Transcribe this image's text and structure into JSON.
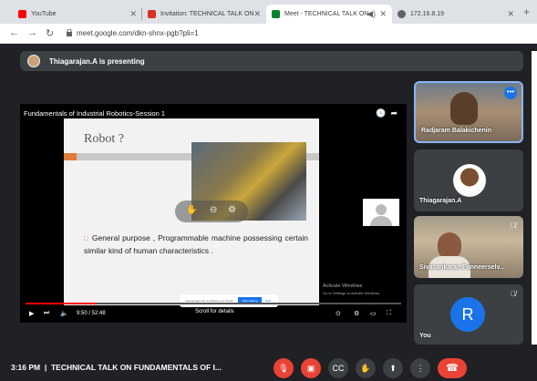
{
  "browser": {
    "tabs": [
      {
        "title": "YouTube",
        "icon": "youtube-icon",
        "color": "#ff0000"
      },
      {
        "title": "Invitation: TECHNICAL TALK ON",
        "icon": "gmail-icon",
        "color": "#d93025"
      },
      {
        "title": "Meet - TECHNICAL TALK ON",
        "icon": "meet-icon",
        "color": "#00832d"
      },
      {
        "title": "172.16.8.19",
        "icon": "globe-icon",
        "color": "#5f6368"
      }
    ],
    "new_tab": "+",
    "url": "meet.google.com/dkn-shnx-pgb?pli=1"
  },
  "banner": {
    "text": "Thiagarajan.A is presenting"
  },
  "video": {
    "title": "Fundamentals of Industrial Robotics-Session 1",
    "slide_title": "Robot ?",
    "slide_body": "General purpose , Programmable machine possessing certain similar kind of human characteristics .",
    "time": "9:50 / 52:48",
    "scroll_hint": "Scroll for details",
    "progress": 0.186
  },
  "share_popup": {
    "text": "meet.google.com is sharing your screen.",
    "stop": "Stop sharing",
    "hide": "Hide"
  },
  "activate": {
    "title": "Activate Windows",
    "sub": "Go to Settings to activate Windows."
  },
  "participants": [
    {
      "name": "Radjaram Balakichenin"
    },
    {
      "name": "Thiagarajan.A"
    },
    {
      "name": "Sivasankaran Panneerselv..."
    },
    {
      "name": "You",
      "initial": "R"
    }
  ],
  "bottom": {
    "time": "3:16 PM",
    "separator": "|",
    "meeting": "TECHNICAL TALK ON FUNDAMENTALS OF I..."
  },
  "colors": {
    "accent": "#1a73e8",
    "danger": "#ea4335",
    "background": "#202124"
  }
}
